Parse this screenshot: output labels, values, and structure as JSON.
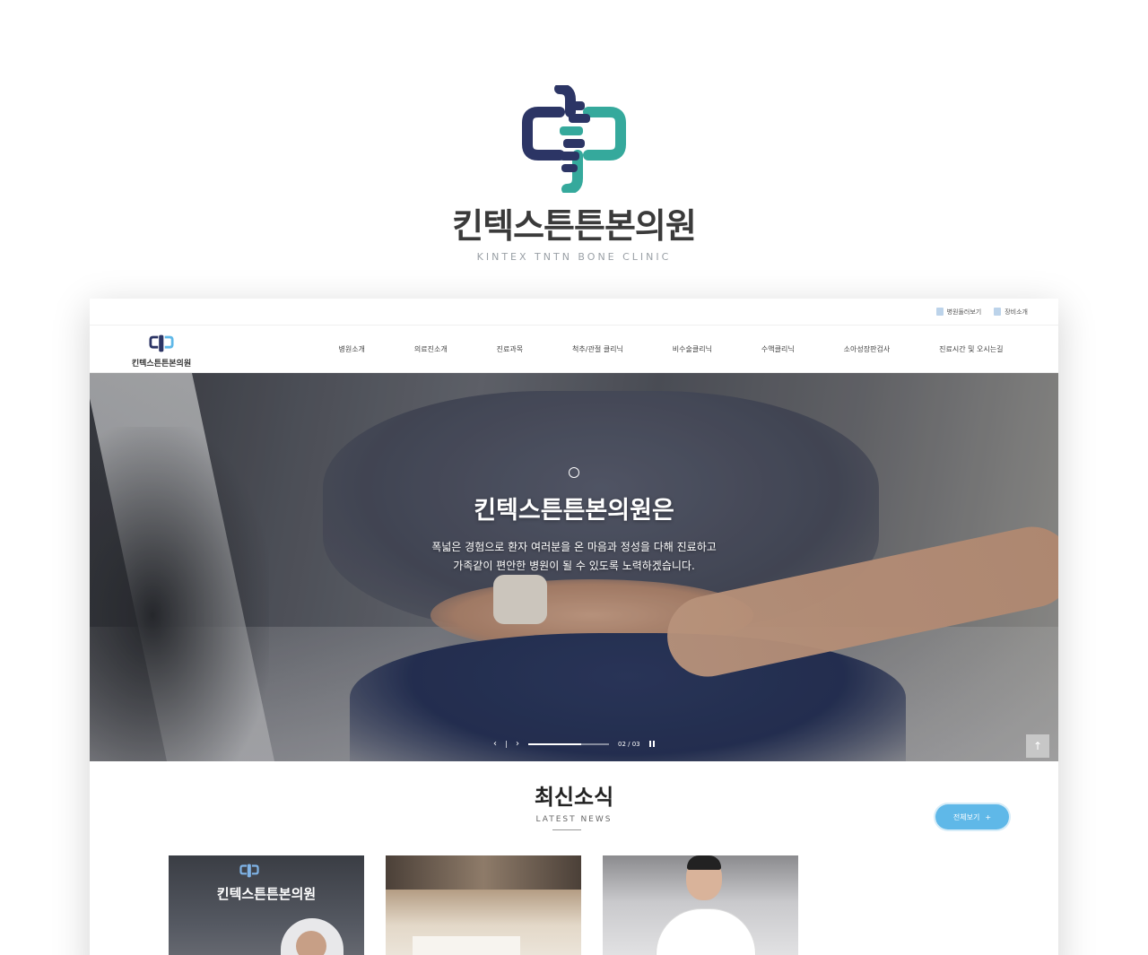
{
  "brand": {
    "name": "킨텍스튼튼본의원",
    "subtitle": "KINTEX TNTN BONE CLINIC",
    "colors": {
      "navy": "#2c3565",
      "teal": "#35a99c"
    }
  },
  "site": {
    "utility_links": [
      {
        "label": "병원둘러보기",
        "icon": "document-icon"
      },
      {
        "label": "장비소개",
        "icon": "document-icon"
      }
    ],
    "logo_text": "킨텍스튼튼본의원",
    "nav_items": [
      {
        "label": "병원소개"
      },
      {
        "label": "의료진소개"
      },
      {
        "label": "진료과목"
      },
      {
        "label": "척추/관절 클리닉"
      },
      {
        "label": "비수술클리닉"
      },
      {
        "label": "수액클리닉"
      },
      {
        "label": "소아성장판검사"
      },
      {
        "label": "진료시간 및 오시는길"
      }
    ],
    "hero": {
      "title": "킨텍스튼튼본의원은",
      "desc_line1": "폭넓은 경험으로 환자 여러분을 온 마음과 정성을 다해 진료하고",
      "desc_line2": "가족같이 편안한 병원이 될 수 있도록 노력하겠습니다.",
      "slide_counter": "02 / 03",
      "slide_progress": 0.66
    },
    "news": {
      "title": "최신소식",
      "subtitle": "LATEST NEWS",
      "view_all": "전체보기",
      "view_all_icon": "+",
      "card1_sign": "킨텍스튼튼본의원"
    },
    "colors": {
      "accent": "#5fb8e8"
    }
  }
}
